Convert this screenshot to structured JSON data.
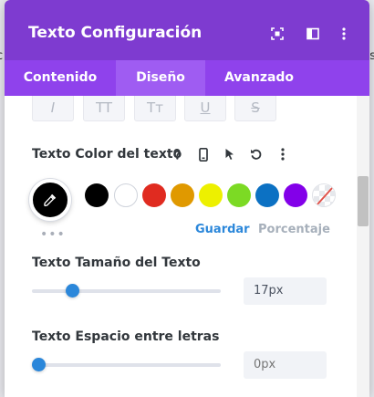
{
  "header": {
    "title": "Texto Configuración",
    "icons": [
      "fullscreen-icon",
      "split-view-icon",
      "more-vertical-icon"
    ]
  },
  "tabs": [
    {
      "label": "Contenido",
      "active": false
    },
    {
      "label": "Diseño",
      "active": true
    },
    {
      "label": "Avanzado",
      "active": false
    }
  ],
  "style_buttons": [
    {
      "label": "I",
      "name": "italic"
    },
    {
      "label": "TT",
      "name": "uppercase"
    },
    {
      "label": "Tт",
      "name": "capitalize"
    },
    {
      "label": "U",
      "name": "underline"
    },
    {
      "label": "S",
      "name": "strikethrough"
    }
  ],
  "text_color": {
    "label": "Texto Color del texto",
    "selected_color": "#000000",
    "swatches": [
      "#000000",
      "#ffffff",
      "#e02b20",
      "#e09900",
      "#edf000",
      "#7cda24",
      "#0c71c3",
      "#8300e9",
      "none"
    ],
    "save_label": "Guardar",
    "percent_label": "Porcentaje",
    "more_label": "•••"
  },
  "font_size": {
    "label": "Texto Tamaño del Texto",
    "value": "17px",
    "slider_fraction": 0.18
  },
  "letter_spacing": {
    "label": "Texto Espacio entre letras",
    "placeholder": "0px",
    "slider_fraction": 0.0
  },
  "colors": {
    "header": "#7e3bd0",
    "tabs": "#8f42ec",
    "active_tab": "#9f5cf2",
    "accent": "#2b87da"
  }
}
